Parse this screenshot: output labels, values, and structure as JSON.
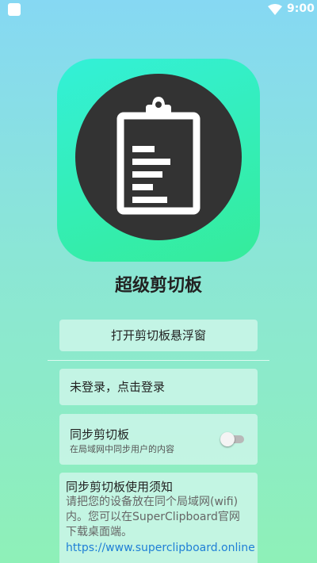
{
  "status_bar": {
    "time": "9:00"
  },
  "app": {
    "title": "超级剪切板"
  },
  "actions": {
    "float_window_label": "打开剪切板悬浮窗"
  },
  "account": {
    "login_label": "未登录，点击登录"
  },
  "sync": {
    "title": "同步剪切板",
    "subtitle": "在局域网中同步用户的内容",
    "enabled": false
  },
  "notice": {
    "title": "同步剪切板使用须知",
    "body_line1": "请把您的设备放在同个局域网(wifi)",
    "body_line2": "内。您可以在SuperClipboard官网",
    "body_line3": "下载桌面端。",
    "link": "https://www.superclipboard.online"
  },
  "colors": {
    "accent_link": "#1f7fd6",
    "icon_gradient_top": "#33f0d8",
    "icon_gradient_bottom": "#35ec9a",
    "icon_circle": "#333333"
  },
  "icons": [
    "notification-square-icon",
    "wifi-icon",
    "clipboard-icon"
  ]
}
